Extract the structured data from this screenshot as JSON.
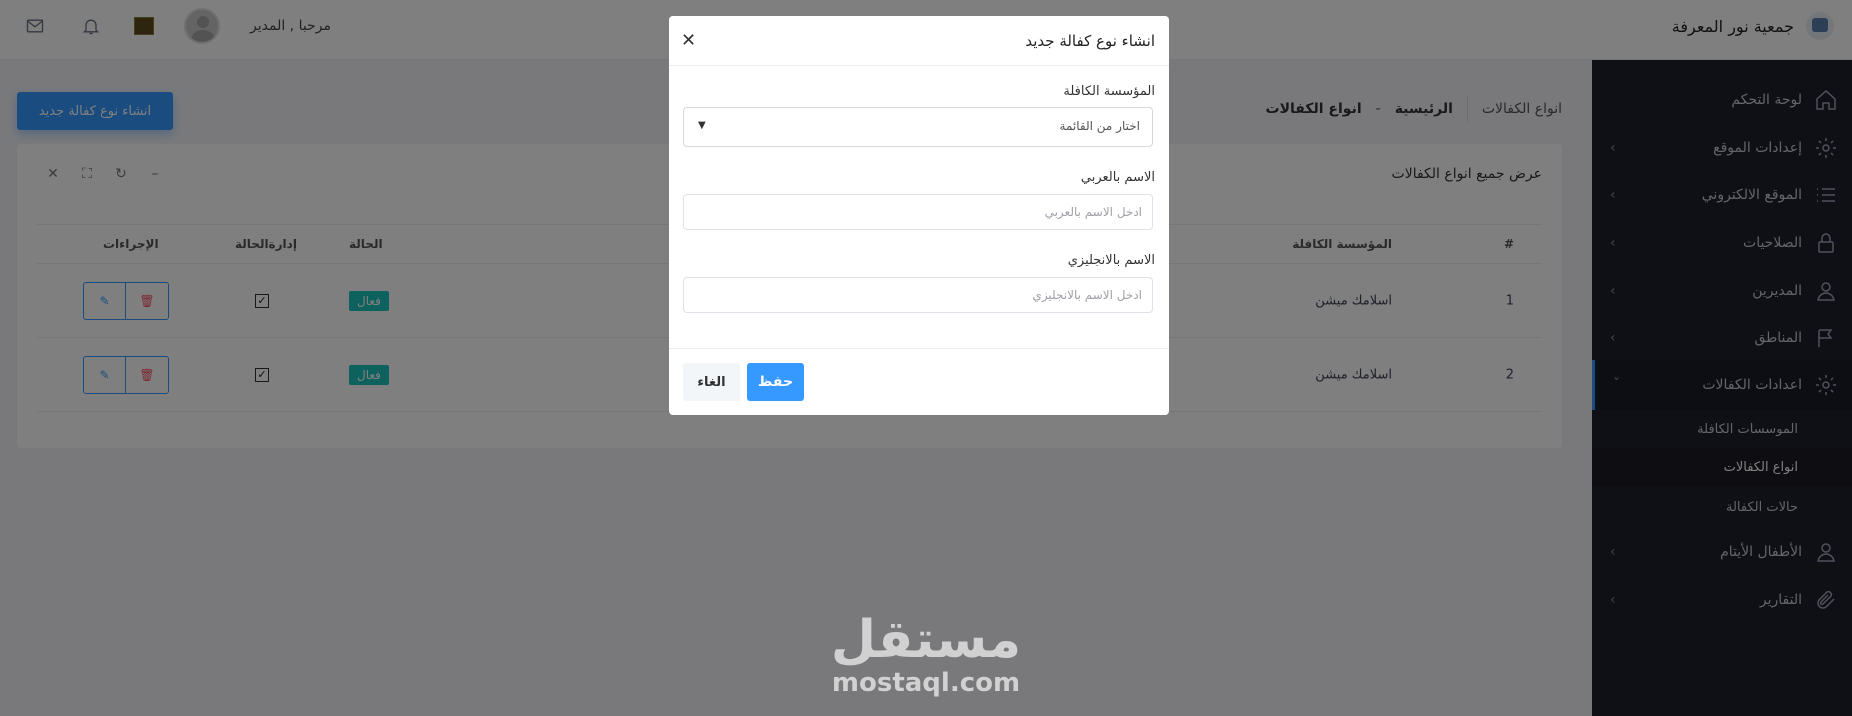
{
  "header": {
    "brand": "جمعية نور المعرفة",
    "welcome": "مرحبا , المدير"
  },
  "sidebar": {
    "items": [
      {
        "label": "لوحة التحكم",
        "icon": "home-icon"
      },
      {
        "label": "إعدادات الموقع",
        "icon": "gear-icon"
      },
      {
        "label": "الموقع الالكتروني",
        "icon": "list-icon"
      },
      {
        "label": "الصلاحيات",
        "icon": "lock-icon"
      },
      {
        "label": "المديرين",
        "icon": "user-icon"
      },
      {
        "label": "المناطق",
        "icon": "flag-icon"
      },
      {
        "label": "اعدادات الكفالات",
        "icon": "gear-icon"
      }
    ],
    "subitems": [
      "الموسسات الكافلة",
      "انواع الكفالات",
      "حالات الكفالة"
    ],
    "after": [
      {
        "label": "الأطفال الأيتام",
        "icon": "user-icon"
      },
      {
        "label": "التقارير",
        "icon": "paperclip-icon"
      }
    ]
  },
  "breadcrumb": {
    "section": "انواع الكفالات",
    "home": "الرئيسية",
    "sep": "-",
    "current": "انواع الكفالات"
  },
  "create_button": "انشاء نوع كفالة جديد",
  "card": {
    "title": "عرض جميع انواع الكفالات",
    "columns": {
      "num": "#",
      "org": "المؤسسة الكافلة",
      "status": "الحالة",
      "manage": "إدارةالحالة",
      "actions": "الإجراءات"
    },
    "rows": [
      {
        "num": "1",
        "org": "اسلامك ميشن",
        "status": "فعال"
      },
      {
        "num": "2",
        "org": "اسلامك ميشن",
        "status": "فعال"
      }
    ]
  },
  "watermark": {
    "ar": "مستقل",
    "en": "mostaql.com"
  },
  "modal": {
    "title": "انشاء نوع كفالة جديد",
    "org_label": "المؤسسة الكافلة",
    "org_value": "اختار من القائمة",
    "ar_label": "الاسم بالعربي",
    "ar_placeholder": "ادخل الاسم بالعربي",
    "en_label": "الاسم بالانجليزي",
    "en_placeholder": "ادخل الاسم بالانجليزي",
    "save": "حفظ",
    "cancel": "الغاء"
  }
}
